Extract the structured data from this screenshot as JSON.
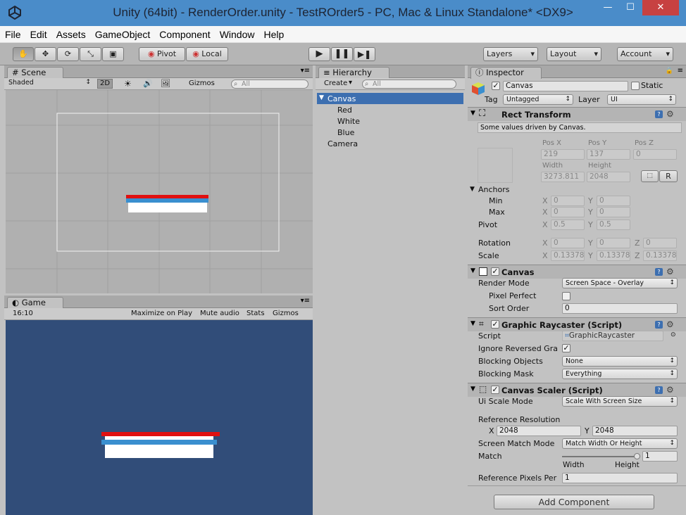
{
  "window": {
    "title": "Unity (64bit) - RenderOrder.unity - TestROrder5 - PC, Mac & Linux Standalone* <DX9>",
    "minimize": "—",
    "maximize": "☐",
    "close": "✕"
  },
  "menu": [
    "File",
    "Edit",
    "Assets",
    "GameObject",
    "Component",
    "Window",
    "Help"
  ],
  "toolbar": {
    "pivot": "Pivot",
    "local": "Local",
    "layers": "Layers",
    "layout": "Layout",
    "account": "Account"
  },
  "scene": {
    "tab": "Scene",
    "shading": "Shaded",
    "mode2d": "2D",
    "gizmos": "Gizmos",
    "search": "All"
  },
  "game": {
    "tab": "Game",
    "aspect": "16:10",
    "maximize": "Maximize on Play",
    "mute": "Mute audio",
    "stats": "Stats",
    "gizmos": "Gizmos"
  },
  "hierarchy": {
    "tab": "Hierarchy",
    "create": "Create",
    "search": "All",
    "items": [
      {
        "label": "Canvas"
      },
      {
        "label": "Red"
      },
      {
        "label": "White"
      },
      {
        "label": "Blue"
      },
      {
        "label": "Camera"
      }
    ]
  },
  "inspector": {
    "tab": "Inspector",
    "object_name": "Canvas",
    "static_label": "Static",
    "tag_label": "Tag",
    "tag_value": "Untagged",
    "layer_label": "Layer",
    "layer_value": "UI",
    "rect": {
      "title": "Rect Transform",
      "info": "Some values driven by Canvas.",
      "posx_label": "Pos X",
      "posy_label": "Pos Y",
      "posz_label": "Pos Z",
      "posx": "219",
      "posy": "137",
      "posz": "0",
      "width_label": "Width",
      "height_label": "Height",
      "width": "3273.811",
      "height": "2048",
      "r_btn": "R",
      "anchors": "Anchors",
      "min": "Min",
      "max": "Max",
      "min_x": "0",
      "min_y": "0",
      "max_x": "0",
      "max_y": "0",
      "pivot": "Pivot",
      "pivot_x": "0.5",
      "pivot_y": "0.5",
      "rotation": "Rotation",
      "rot_x": "0",
      "rot_y": "0",
      "rot_z": "0",
      "scale": "Scale",
      "scale_x": "0.13378",
      "scale_y": "0.13378",
      "scale_z": "0.13378",
      "x": "X",
      "y": "Y",
      "z": "Z"
    },
    "canvas": {
      "title": "Canvas",
      "render_mode_label": "Render Mode",
      "render_mode": "Screen Space - Overlay",
      "pixel_perfect_label": "Pixel Perfect",
      "sort_order_label": "Sort Order",
      "sort_order": "0"
    },
    "raycaster": {
      "title": "Graphic Raycaster (Script)",
      "script_label": "Script",
      "script": "GraphicRaycaster",
      "ignore_label": "Ignore Reversed Gra",
      "blocking_objects_label": "Blocking Objects",
      "blocking_objects": "None",
      "blocking_mask_label": "Blocking Mask",
      "blocking_mask": "Everything"
    },
    "scaler": {
      "title": "Canvas Scaler (Script)",
      "ui_scale_label": "Ui Scale Mode",
      "ui_scale": "Scale With Screen Size",
      "ref_res_label": "Reference Resolution",
      "ref_x": "2048",
      "ref_y": "2048",
      "match_mode_label": "Screen Match Mode",
      "match_mode": "Match Width Or Height",
      "match_label": "Match",
      "match_value": "1",
      "width_label": "Width",
      "height_label": "Height",
      "ref_pixels_label": "Reference Pixels Per",
      "ref_pixels": "1"
    },
    "add_component": "Add Component"
  },
  "colors": {
    "game_bg": "#314d79",
    "selected": "#3d6fb0",
    "red": "#e01010",
    "blue": "#3a8fcf"
  }
}
